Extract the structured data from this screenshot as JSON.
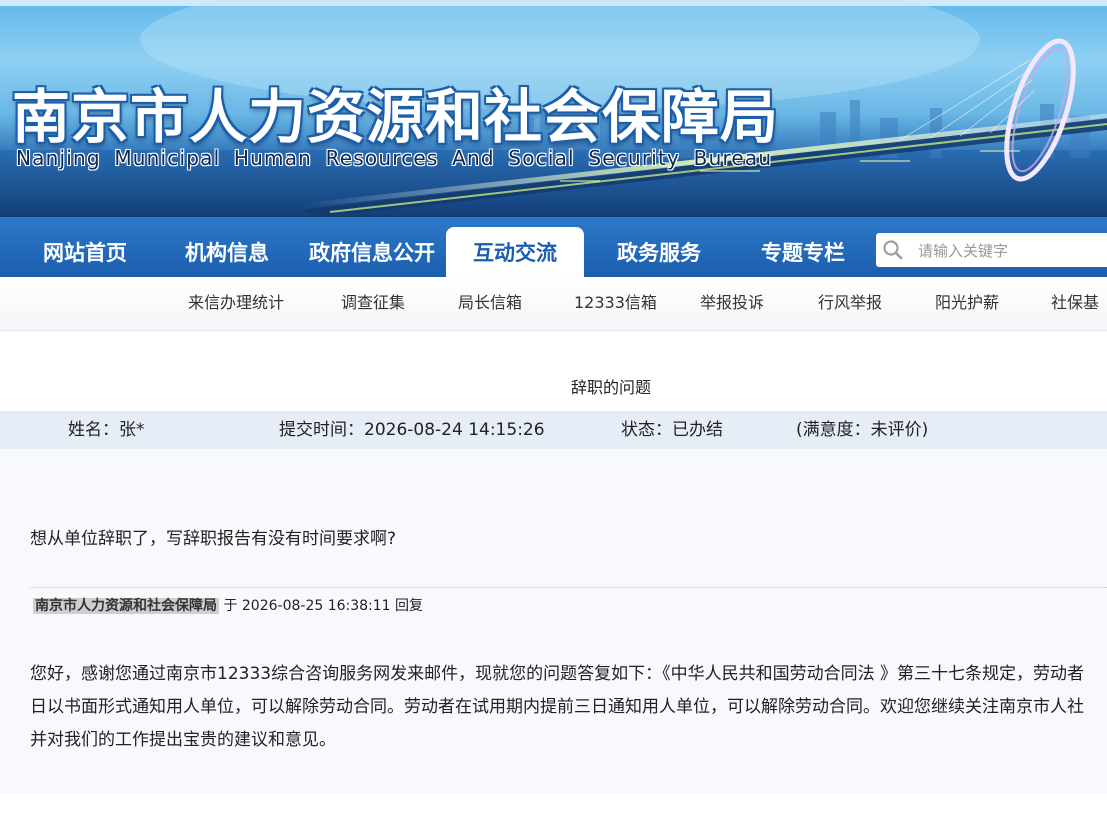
{
  "header": {
    "title_cn": "南京市人力资源和社会保障局",
    "title_en": "Nanjing Municipal Human Resources And Social Security Bureau"
  },
  "nav": {
    "items": [
      {
        "label": "网站首页",
        "active": false
      },
      {
        "label": "机构信息",
        "active": false
      },
      {
        "label": "政府信息公开",
        "active": false
      },
      {
        "label": "互动交流",
        "active": true
      },
      {
        "label": "政务服务",
        "active": false
      },
      {
        "label": "专题专栏",
        "active": false
      }
    ],
    "search_placeholder": "请输入关键字"
  },
  "subnav": {
    "items": [
      "来信办理统计",
      "调查征集",
      "局长信箱",
      "12333信箱",
      "举报投诉",
      "行风举报",
      "阳光护薪",
      "社保基"
    ]
  },
  "letter": {
    "title": "辞职的问题",
    "name": "姓名：张*",
    "submit_time": "提交时间：2026-08-24 14:15:26",
    "status": "状态：已办结",
    "satisfaction": "(满意度：未评价)",
    "question": "想从单位辞职了，写辞职报告有没有时间要求啊?",
    "reply_org": "南京市人力资源和社会保障局",
    "reply_meta": " 于 2026-08-25 16:38:11 回复",
    "answer_lines": [
      "您好，感谢您通过南京市12333综合咨询服务网发来邮件，现就您的问题答复如下：《中华人民共和国劳动合同法 》第三十七条规定，劳动者",
      "日以书面形式通知用人单位，可以解除劳动合同。劳动者在试用期内提前三日通知用人单位，可以解除劳动合同。欢迎您继续关注南京市人社",
      "并对我们的工作提出宝贵的建议和意见。"
    ]
  }
}
